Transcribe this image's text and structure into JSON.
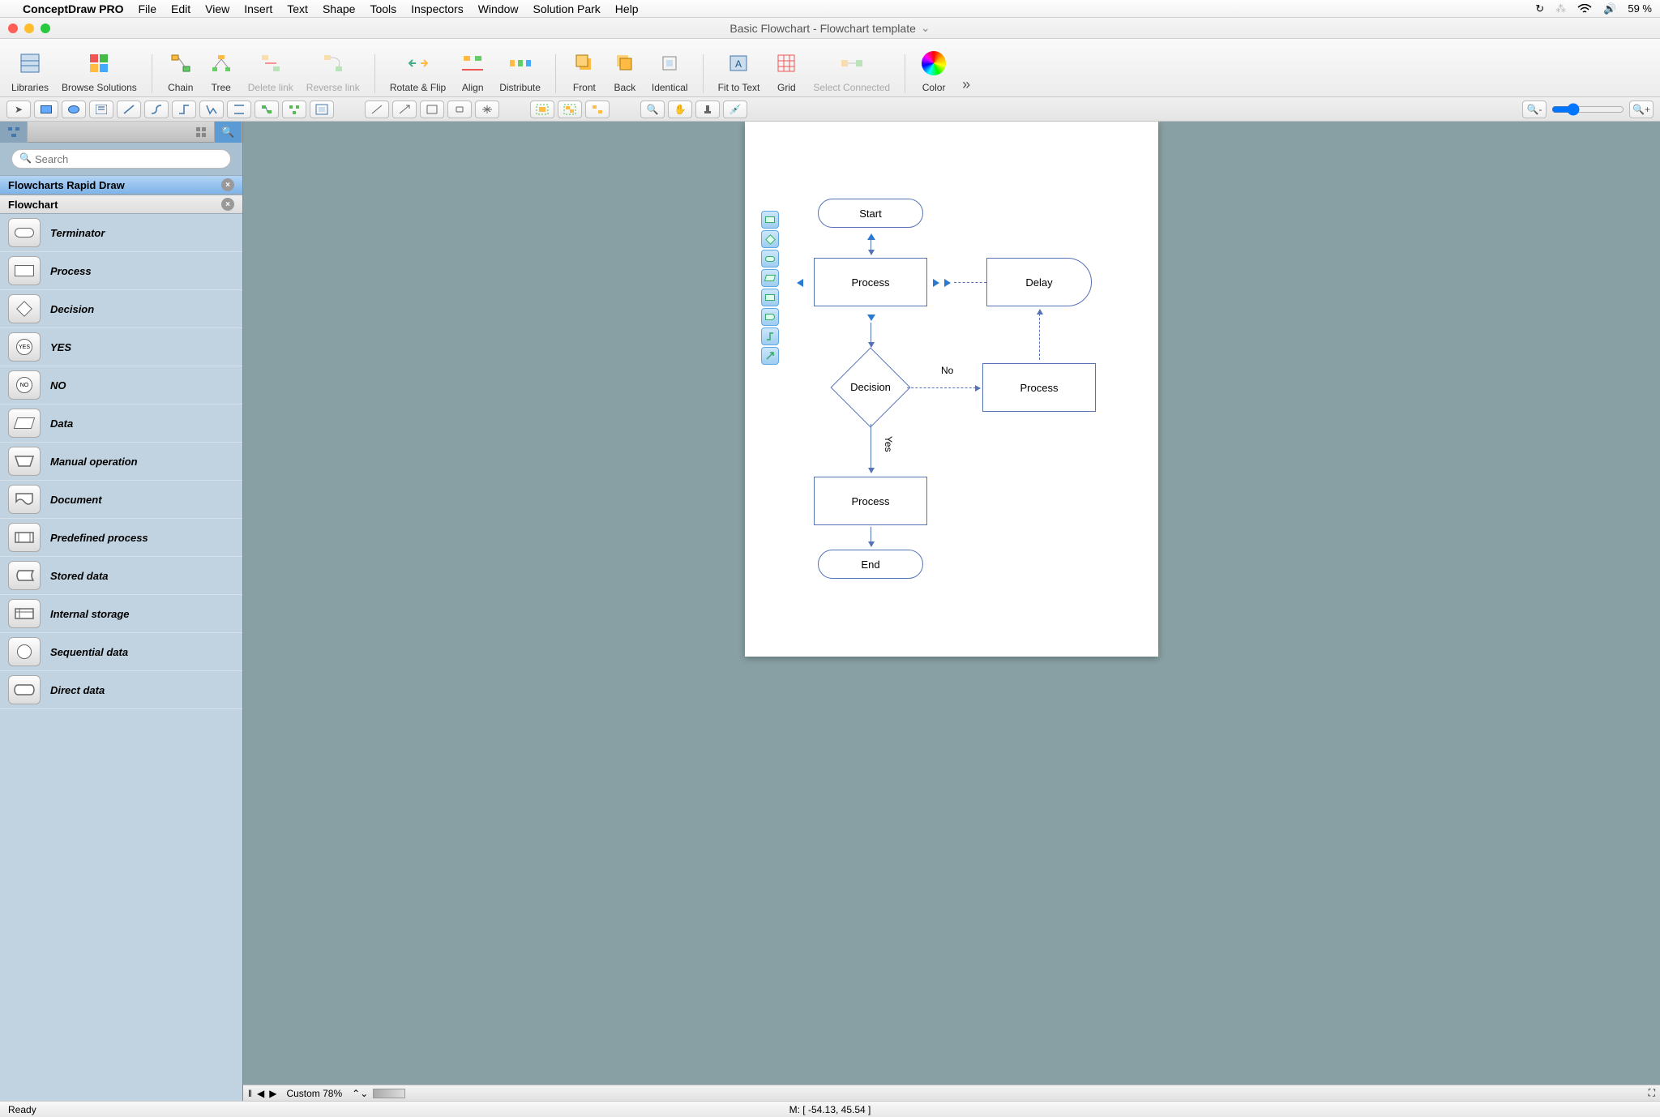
{
  "menu": {
    "app": "ConceptDraw PRO",
    "items": [
      "File",
      "Edit",
      "View",
      "Insert",
      "Text",
      "Shape",
      "Tools",
      "Inspectors",
      "Window",
      "Solution Park",
      "Help"
    ],
    "battery": "59 %"
  },
  "window": {
    "title": "Basic Flowchart - Flowchart template"
  },
  "toolbar": {
    "libraries": "Libraries",
    "browse": "Browse Solutions",
    "chain": "Chain",
    "tree": "Tree",
    "delete_link": "Delete link",
    "reverse_link": "Reverse link",
    "rotate_flip": "Rotate & Flip",
    "align": "Align",
    "distribute": "Distribute",
    "front": "Front",
    "back": "Back",
    "identical": "Identical",
    "fit_text": "Fit to Text",
    "grid": "Grid",
    "select_conn": "Select Connected",
    "color": "Color"
  },
  "sidebar": {
    "search_placeholder": "Search",
    "lib_active": "Flowcharts Rapid Draw",
    "lib_inactive": "Flowchart",
    "shapes": [
      {
        "label": "Terminator",
        "type": "terminator"
      },
      {
        "label": "Process",
        "type": "process"
      },
      {
        "label": "Decision",
        "type": "decision"
      },
      {
        "label": "YES",
        "type": "yes"
      },
      {
        "label": "NO",
        "type": "no"
      },
      {
        "label": "Data",
        "type": "data"
      },
      {
        "label": "Manual operation",
        "type": "manual"
      },
      {
        "label": "Document",
        "type": "document"
      },
      {
        "label": "Predefined process",
        "type": "predefined"
      },
      {
        "label": "Stored data",
        "type": "stored"
      },
      {
        "label": "Internal storage",
        "type": "internal"
      },
      {
        "label": "Sequential data",
        "type": "sequential"
      },
      {
        "label": "Direct data",
        "type": "direct"
      }
    ]
  },
  "canvas": {
    "start": "Start",
    "process1": "Process",
    "decision": "Decision",
    "delay": "Delay",
    "process2": "Process",
    "process3": "Process",
    "end": "End",
    "no": "No",
    "yes": "Yes"
  },
  "hscroll": {
    "zoom": "Custom 78%"
  },
  "status": {
    "ready": "Ready",
    "coords": "M: [ -54.13, 45.54 ]"
  }
}
